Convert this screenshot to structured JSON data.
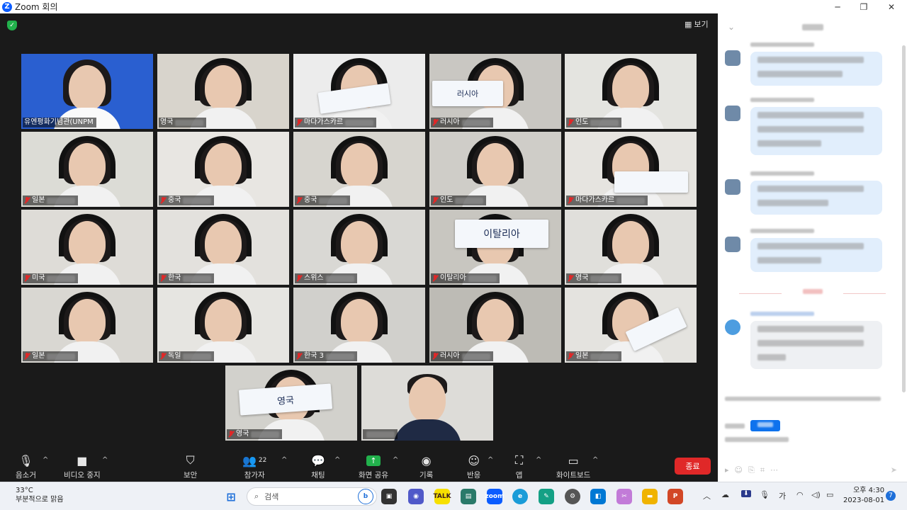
{
  "window": {
    "title": "Zoom 회의",
    "minimize": "─",
    "maximize": "❐",
    "close": "✕"
  },
  "meeting": {
    "view_label": "보기"
  },
  "participants": [
    {
      "name": "유엔평화기념관(UNPM",
      "muted": false,
      "bg": "#2a5fd0"
    },
    {
      "name": "영국",
      "muted": false,
      "bg": "#d8d4cc",
      "active": true
    },
    {
      "name": "마다가스카르",
      "muted": true,
      "bg": "#ececec"
    },
    {
      "name": "러시아",
      "muted": true,
      "bg": "#c9c7c2"
    },
    {
      "name": "인도",
      "muted": true,
      "bg": "#e4e4e0"
    },
    {
      "name": "일본",
      "muted": true,
      "bg": "#dcdcd6"
    },
    {
      "name": "중국",
      "muted": true,
      "bg": "#e8e6e2"
    },
    {
      "name": "중국",
      "muted": true,
      "bg": "#d7d5cf"
    },
    {
      "name": "인도",
      "muted": true,
      "bg": "#cfcdc8"
    },
    {
      "name": "마다가스카르",
      "muted": true,
      "bg": "#e6e4e0"
    },
    {
      "name": "미국",
      "muted": true,
      "bg": "#dedcd7"
    },
    {
      "name": "한국",
      "muted": true,
      "bg": "#e3e1dd"
    },
    {
      "name": "스위스",
      "muted": true,
      "bg": "#d9d8d4"
    },
    {
      "name": "이탈리아",
      "muted": true,
      "bg": "#c8c6c0"
    },
    {
      "name": "영국",
      "muted": true,
      "bg": "#e0dfdb"
    },
    {
      "name": "일본",
      "muted": true,
      "bg": "#d9d7d2"
    },
    {
      "name": "독일",
      "muted": true,
      "bg": "#e6e5e1"
    },
    {
      "name": "한국 3",
      "muted": true,
      "bg": "#d1d0cc"
    },
    {
      "name": "러시아",
      "muted": true,
      "bg": "#bdbbb5"
    },
    {
      "name": "일본",
      "muted": true,
      "bg": "#e4e3df"
    },
    {
      "name": "영국",
      "muted": true,
      "bg": "#d2d1cc"
    },
    {
      "name": "",
      "muted": false,
      "bg": "#dddcd8"
    }
  ],
  "cards": {
    "russia": "러시아",
    "italy": "이탈리아",
    "uk": "영국"
  },
  "toolbar": {
    "mute": "음소거",
    "video": "비디오 중지",
    "security": "보안",
    "participants": "참가자",
    "participant_count": "22",
    "chat": "채팅",
    "share": "화면 공유",
    "record": "기록",
    "reactions": "반응",
    "apps": "앱",
    "whiteboard": "화이트보드",
    "end": "종료"
  },
  "taskbar": {
    "temperature": "33°C",
    "weather": "부분적으로 맑음",
    "search": "검색",
    "time": "오후 4:30",
    "date": "2023-08-01",
    "ime": "가",
    "notif_count": "7"
  },
  "colors": {
    "accent": "#0e72ed",
    "end": "#e02828",
    "share": "#22b14c"
  }
}
